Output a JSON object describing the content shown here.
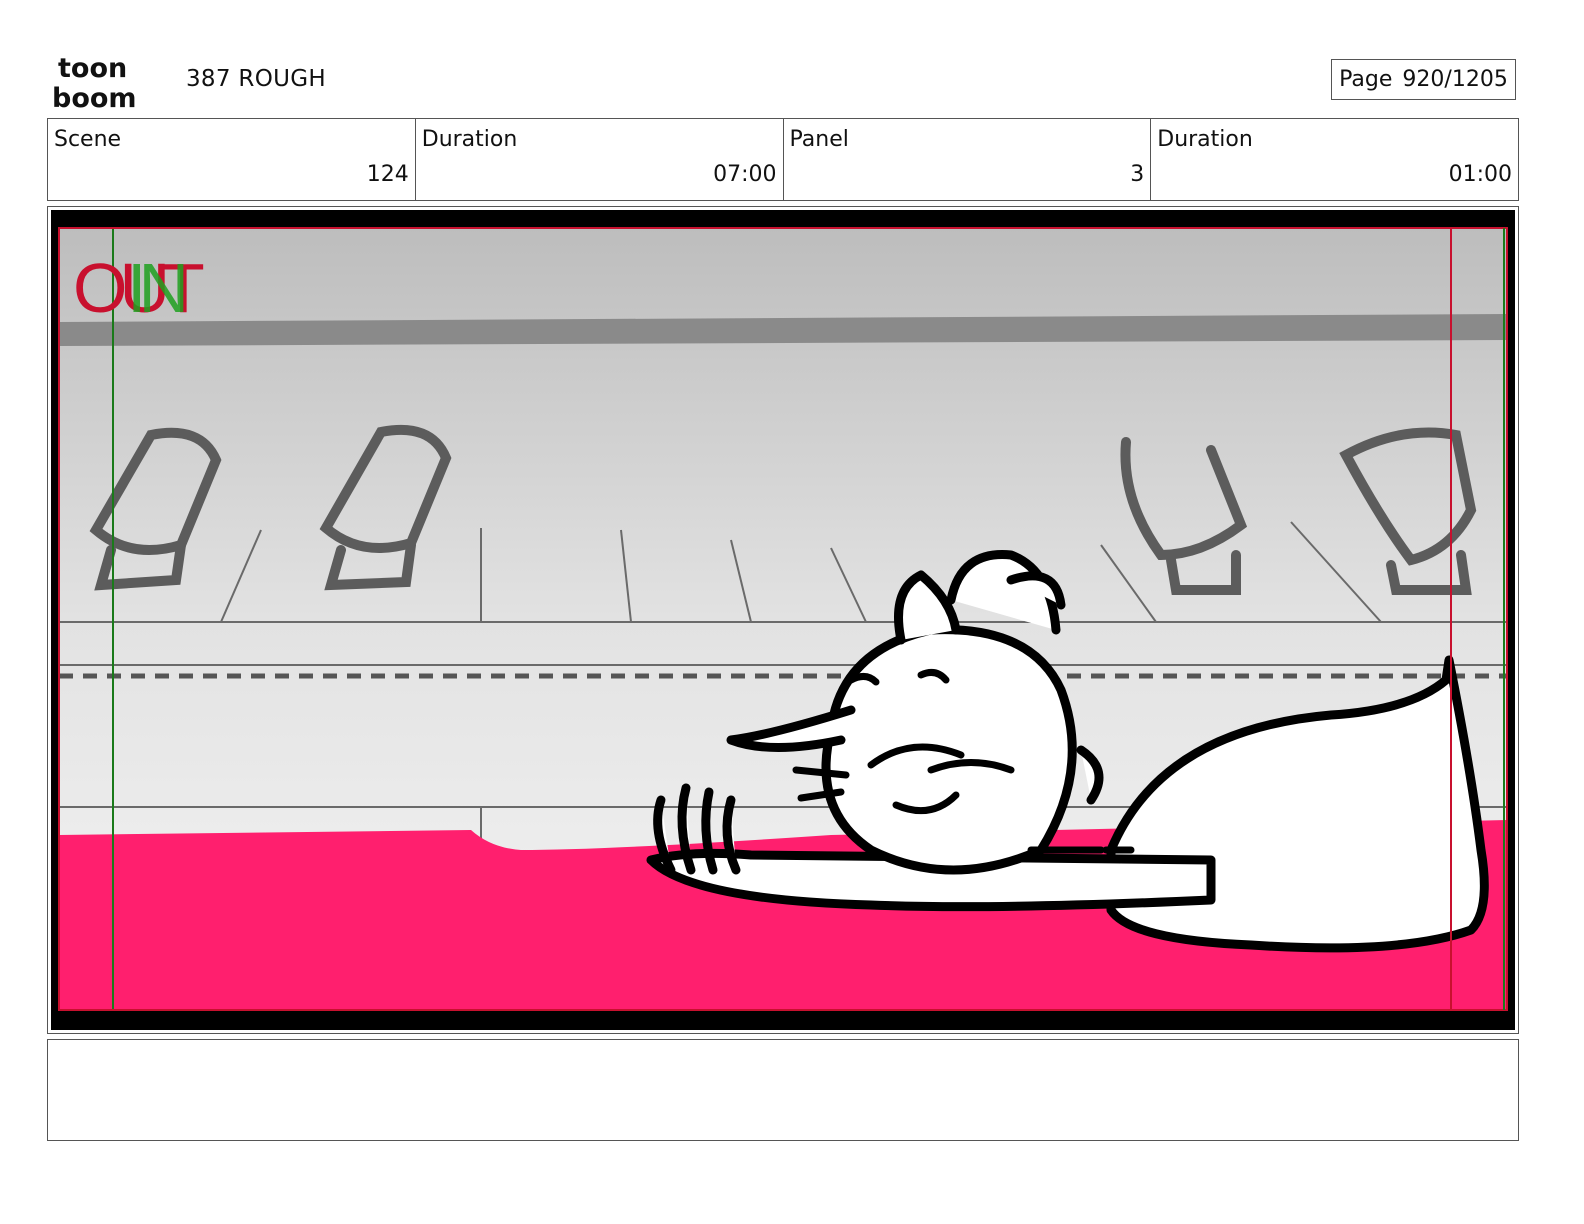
{
  "header": {
    "logo_text_top": "toon",
    "logo_text_bottom": "boom",
    "project_title": "387 ROUGH",
    "page_label": "Page",
    "page_value": "920/1205"
  },
  "info": {
    "scene_label": "Scene",
    "scene_value": "124",
    "scene_duration_label": "Duration",
    "scene_duration_value": "07:00",
    "panel_label": "Panel",
    "panel_value": "3",
    "panel_duration_label": "Duration",
    "panel_duration_value": "01:00"
  },
  "panel": {
    "safe_overlay_out": "OUT",
    "safe_overlay_in": "IN",
    "colors": {
      "out_marker": "#c8102e",
      "in_marker": "#1fa01f",
      "carpet": "#ff1f6e",
      "letterbox": "#000000"
    }
  },
  "caption": {
    "text": ""
  }
}
